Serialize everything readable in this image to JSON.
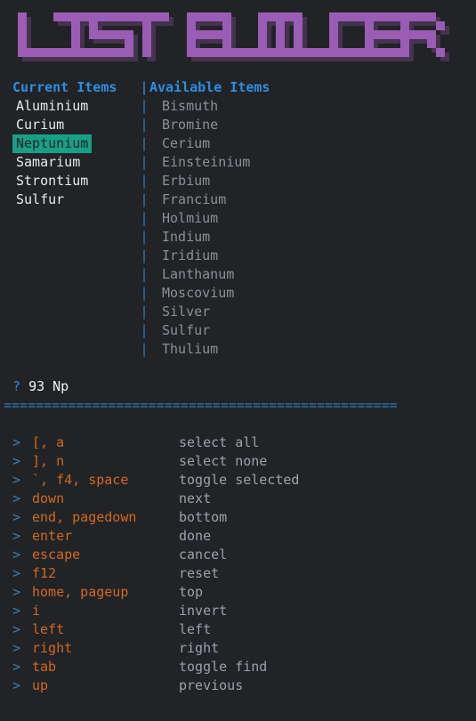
{
  "banner": {
    "text": "LIST BUILDER",
    "style": "block-ascii-art",
    "fg_color": "#9a5cb4",
    "shadow_color": "#453350"
  },
  "columns": {
    "current_header": "Current Items",
    "available_header": "Available Items",
    "divider": "|"
  },
  "current_items": [
    {
      "label": "Aluminium",
      "selected": false
    },
    {
      "label": "Curium",
      "selected": false
    },
    {
      "label": "Neptunium",
      "selected": true
    },
    {
      "label": "Samarium",
      "selected": false
    },
    {
      "label": "Strontium",
      "selected": false
    },
    {
      "label": "Sulfur",
      "selected": false
    }
  ],
  "available_items": [
    "Bismuth",
    "Bromine",
    "Cerium",
    "Einsteinium",
    "Erbium",
    "Francium",
    "Holmium",
    "Indium",
    "Iridium",
    "Lanthanum",
    "Moscovium",
    "Silver",
    "Sulfur",
    "Thulium"
  ],
  "prompt": {
    "marker": "?",
    "value": "93 Np"
  },
  "separator": "=================================================",
  "keybindings": [
    {
      "prefix": ">",
      "keys": "[, a",
      "desc": "select all"
    },
    {
      "prefix": ">",
      "keys": "], n",
      "desc": "select none"
    },
    {
      "prefix": ">",
      "keys": "`, f4, space",
      "desc": "toggle selected"
    },
    {
      "prefix": ">",
      "keys": "down",
      "desc": "next"
    },
    {
      "prefix": ">",
      "keys": "end, pagedown",
      "desc": "bottom"
    },
    {
      "prefix": ">",
      "keys": "enter",
      "desc": "done"
    },
    {
      "prefix": ">",
      "keys": "escape",
      "desc": "cancel"
    },
    {
      "prefix": ">",
      "keys": "f12",
      "desc": "reset"
    },
    {
      "prefix": ">",
      "keys": "home, pageup",
      "desc": "top"
    },
    {
      "prefix": ">",
      "keys": "i",
      "desc": "invert"
    },
    {
      "prefix": ">",
      "keys": "left",
      "desc": "left"
    },
    {
      "prefix": ">",
      "keys": "right",
      "desc": "right"
    },
    {
      "prefix": ">",
      "keys": "tab",
      "desc": "toggle find"
    },
    {
      "prefix": ">",
      "keys": "up",
      "desc": "previous"
    }
  ],
  "colors": {
    "background": "#212326",
    "header": "#2b8fe0",
    "current_item": "#e8eaed",
    "available_item": "#8a9199",
    "highlight_bg": "#17a086",
    "highlight_fg": "#20242a",
    "key": "#d2691e",
    "description": "#9aa2ab"
  }
}
